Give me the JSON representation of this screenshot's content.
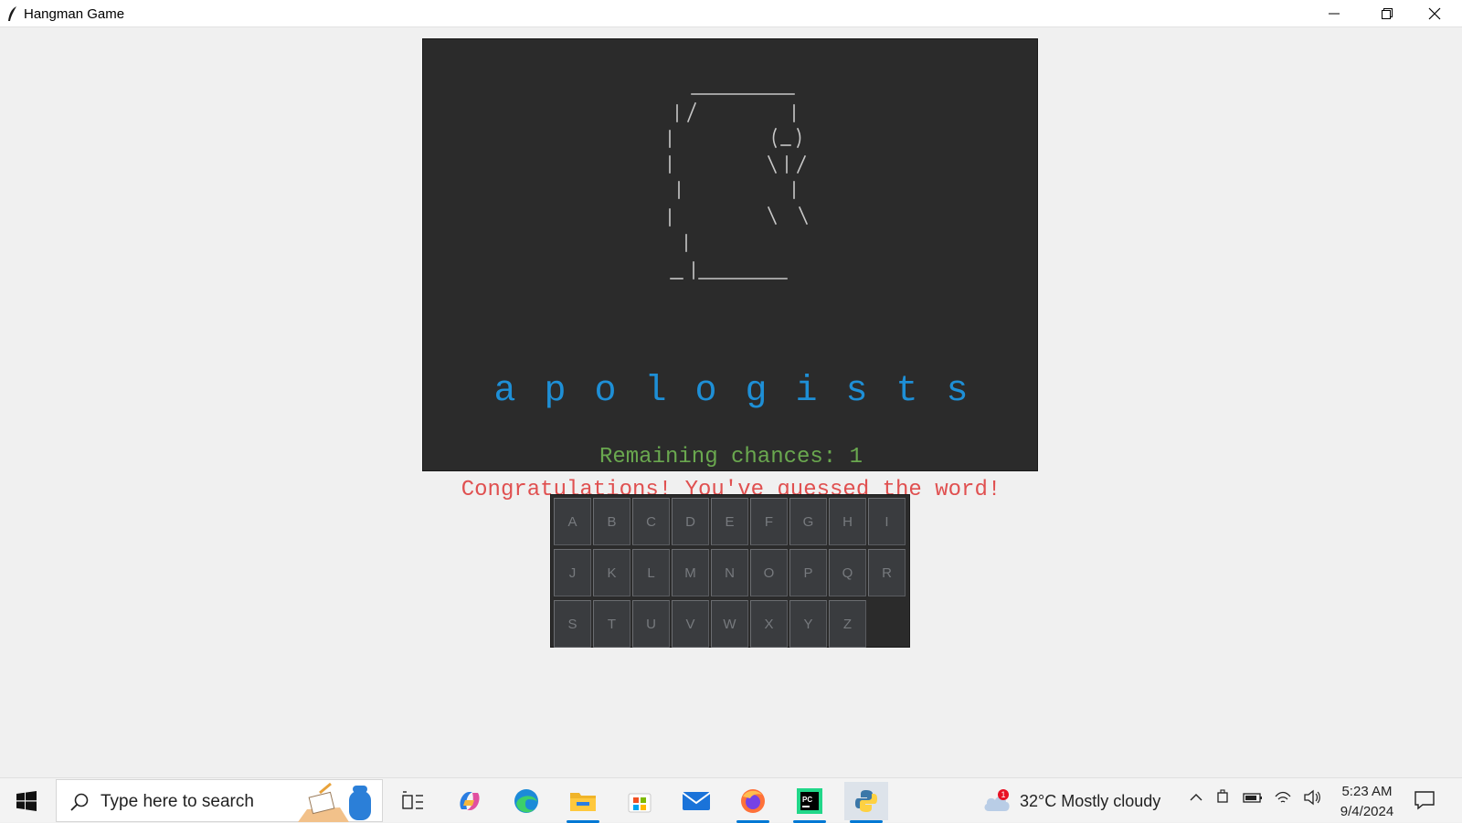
{
  "window": {
    "title": "Hangman Game"
  },
  "game": {
    "word_letters": [
      "a",
      "p",
      "o",
      "l",
      "o",
      "g",
      "i",
      "s",
      "t",
      "s"
    ],
    "remaining_chances_text": "Remaining chances: 1",
    "status_message": "Congratulations! You've guessed the word!"
  },
  "keyboard": {
    "rows": [
      [
        "A",
        "B",
        "C",
        "D",
        "E",
        "F",
        "G",
        "H",
        "I"
      ],
      [
        "J",
        "K",
        "L",
        "M",
        "N",
        "O",
        "P",
        "Q",
        "R"
      ],
      [
        "S",
        "T",
        "U",
        "V",
        "W",
        "X",
        "Y",
        "Z"
      ]
    ]
  },
  "taskbar": {
    "search_placeholder": "Type here to search",
    "weather_badge": "1",
    "weather_text": "32°C  Mostly cloudy",
    "time": "5:23 AM",
    "date": "9/4/2024",
    "apps": [
      "task-view-icon",
      "copilot-icon",
      "edge-icon",
      "file-explorer-icon",
      "microsoft-store-icon",
      "mail-icon",
      "firefox-icon",
      "pycharm-icon",
      "python-icon"
    ]
  }
}
